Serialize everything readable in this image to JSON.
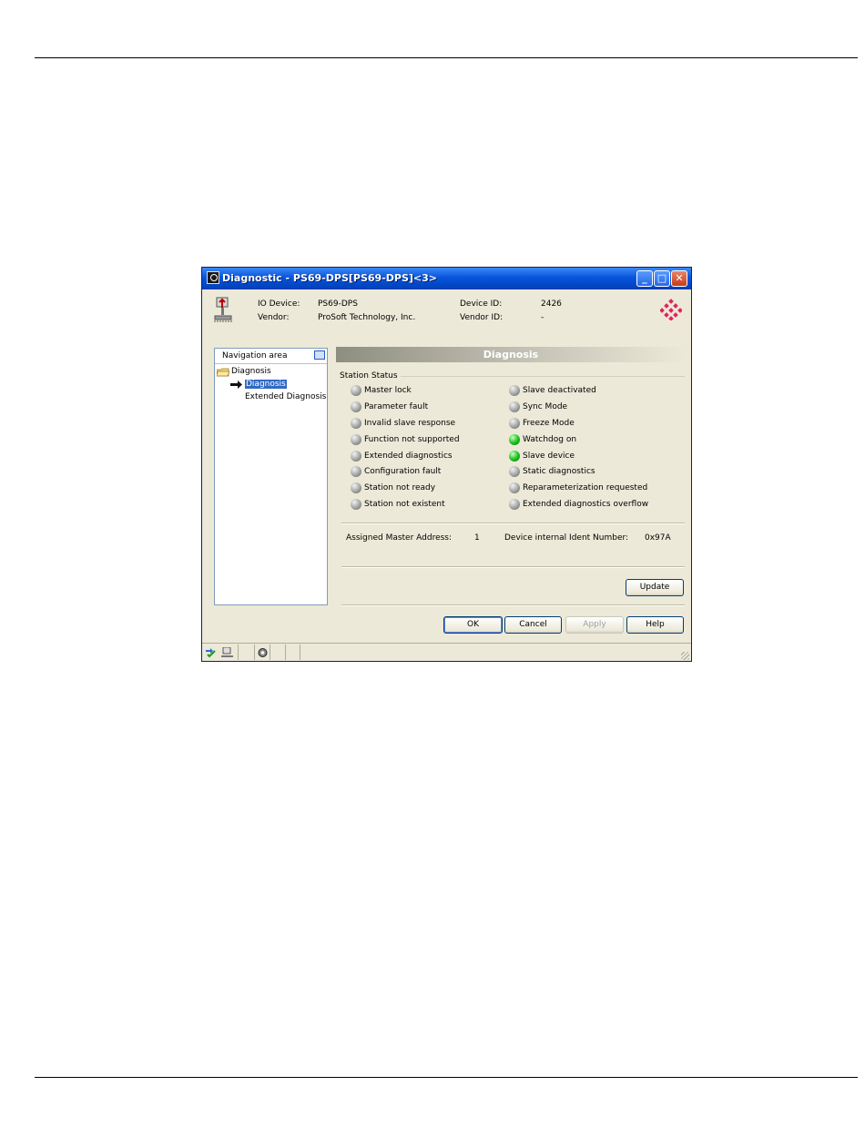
{
  "window": {
    "title": "Diagnostic - PS69-DPS[PS69-DPS]<3>",
    "controls": {
      "minimize": "_",
      "maximize": "□",
      "close": "✕"
    }
  },
  "device_info": {
    "io_device_label": "IO Device:",
    "io_device_value": "PS69-DPS",
    "vendor_label": "Vendor:",
    "vendor_value": "ProSoft Technology, Inc.",
    "device_id_label": "Device ID:",
    "device_id_value": "2426",
    "vendor_id_label": "Vendor ID:",
    "vendor_id_value": "-"
  },
  "navigation": {
    "header": "Navigation area",
    "root": "Diagnosis",
    "items": [
      {
        "label": "Diagnosis",
        "selected": true
      },
      {
        "label": "Extended Diagnosis",
        "selected": false
      }
    ]
  },
  "main": {
    "title": "Diagnosis",
    "group_label": "Station Status",
    "status_left": [
      {
        "label": "Master lock",
        "state": "off"
      },
      {
        "label": "Parameter fault",
        "state": "off"
      },
      {
        "label": "Invalid slave response",
        "state": "off"
      },
      {
        "label": "Function not supported",
        "state": "off"
      },
      {
        "label": "Extended diagnostics",
        "state": "off"
      },
      {
        "label": "Configuration fault",
        "state": "off"
      },
      {
        "label": "Station not ready",
        "state": "off"
      },
      {
        "label": "Station not existent",
        "state": "off"
      }
    ],
    "status_right": [
      {
        "label": "Slave deactivated",
        "state": "off"
      },
      {
        "label": "Sync Mode",
        "state": "off"
      },
      {
        "label": "Freeze Mode",
        "state": "off"
      },
      {
        "label": "Watchdog on",
        "state": "on"
      },
      {
        "label": "Slave device",
        "state": "on"
      },
      {
        "label": "Static diagnostics",
        "state": "off"
      },
      {
        "label": "Reparameterization requested",
        "state": "off"
      },
      {
        "label": "Extended diagnostics overflow",
        "state": "off"
      }
    ],
    "assigned_master_label": "Assigned Master Address:",
    "assigned_master_value": "1",
    "ident_label": "Device internal Ident Number:",
    "ident_value": "0x97A",
    "update_button": "Update"
  },
  "buttons": {
    "ok": "OK",
    "cancel": "Cancel",
    "apply": "Apply",
    "help": "Help"
  },
  "colors": {
    "led_on": "#22c622",
    "led_off": "#a3a3a3",
    "selection": "#316ac5"
  }
}
